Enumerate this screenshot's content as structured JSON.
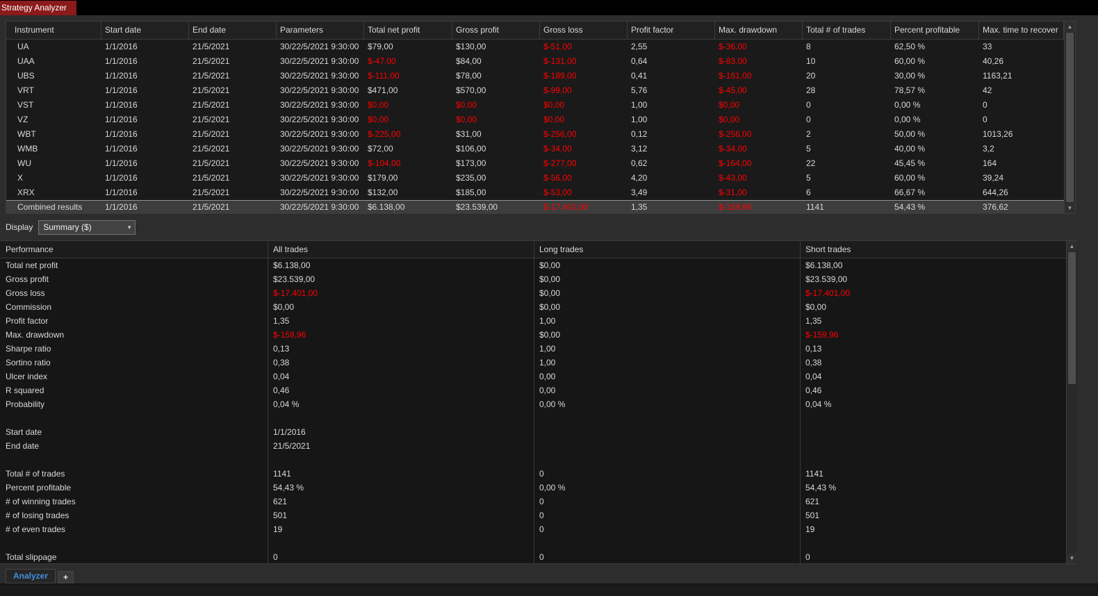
{
  "title_tab": {
    "label": "Strategy Analyzer"
  },
  "results_table": {
    "columns": [
      "Instrument",
      "Start date",
      "End date",
      "Parameters",
      "Total net profit",
      "Gross profit",
      "Gross loss",
      "Profit factor",
      "Max. drawdown",
      "Total # of trades",
      "Percent profitable",
      "Max. time to recover"
    ],
    "rows": [
      {
        "cells": [
          "UA",
          "1/1/2016",
          "21/5/2021",
          "30/22/5/2021 9:30:00",
          "$79,00",
          "$130,00",
          "$-51,00",
          "2,55",
          "$-36,00",
          "8",
          "62,50 %",
          "33"
        ],
        "red": [
          6,
          8
        ]
      },
      {
        "cells": [
          "UAA",
          "1/1/2016",
          "21/5/2021",
          "30/22/5/2021 9:30:00",
          "$-47,00",
          "$84,00",
          "$-131,00",
          "0,64",
          "$-83,00",
          "10",
          "60,00 %",
          "40,26"
        ],
        "red": [
          4,
          6,
          8
        ]
      },
      {
        "cells": [
          "UBS",
          "1/1/2016",
          "21/5/2021",
          "30/22/5/2021 9:30:00",
          "$-111,00",
          "$78,00",
          "$-189,00",
          "0,41",
          "$-161,00",
          "20",
          "30,00 %",
          "1163,21"
        ],
        "red": [
          4,
          6,
          8
        ]
      },
      {
        "cells": [
          "VRT",
          "1/1/2016",
          "21/5/2021",
          "30/22/5/2021 9:30:00",
          "$471,00",
          "$570,00",
          "$-99,00",
          "5,76",
          "$-45,00",
          "28",
          "78,57 %",
          "42"
        ],
        "red": [
          6,
          8
        ]
      },
      {
        "cells": [
          "VST",
          "1/1/2016",
          "21/5/2021",
          "30/22/5/2021 9:30:00",
          "$0,00",
          "$0,00",
          "$0,00",
          "1,00",
          "$0,00",
          "0",
          "0,00 %",
          "0"
        ],
        "red": [
          4,
          5,
          6,
          8
        ]
      },
      {
        "cells": [
          "VZ",
          "1/1/2016",
          "21/5/2021",
          "30/22/5/2021 9:30:00",
          "$0,00",
          "$0,00",
          "$0,00",
          "1,00",
          "$0,00",
          "0",
          "0,00 %",
          "0"
        ],
        "red": [
          4,
          5,
          6,
          8
        ]
      },
      {
        "cells": [
          "WBT",
          "1/1/2016",
          "21/5/2021",
          "30/22/5/2021 9:30:00",
          "$-225,00",
          "$31,00",
          "$-256,00",
          "0,12",
          "$-256,00",
          "2",
          "50,00 %",
          "1013,26"
        ],
        "red": [
          4,
          6,
          8
        ]
      },
      {
        "cells": [
          "WMB",
          "1/1/2016",
          "21/5/2021",
          "30/22/5/2021 9:30:00",
          "$72,00",
          "$106,00",
          "$-34,00",
          "3,12",
          "$-34,00",
          "5",
          "40,00 %",
          "3,2"
        ],
        "red": [
          6,
          8
        ]
      },
      {
        "cells": [
          "WU",
          "1/1/2016",
          "21/5/2021",
          "30/22/5/2021 9:30:00",
          "$-104,00",
          "$173,00",
          "$-277,00",
          "0,62",
          "$-164,00",
          "22",
          "45,45 %",
          "164"
        ],
        "red": [
          4,
          6,
          8
        ]
      },
      {
        "cells": [
          "X",
          "1/1/2016",
          "21/5/2021",
          "30/22/5/2021 9:30:00",
          "$179,00",
          "$235,00",
          "$-56,00",
          "4,20",
          "$-43,00",
          "5",
          "60,00 %",
          "39,24"
        ],
        "red": [
          6,
          8
        ]
      },
      {
        "cells": [
          "XRX",
          "1/1/2016",
          "21/5/2021",
          "30/22/5/2021 9:30:00",
          "$132,00",
          "$185,00",
          "$-53,00",
          "3,49",
          "$-31,00",
          "6",
          "66,67 %",
          "644,26"
        ],
        "red": [
          6,
          8
        ]
      },
      {
        "cells": [
          "Combined results",
          "1/1/2016",
          "21/5/2021",
          "30/22/5/2021 9:30:00",
          "$6.138,00",
          "$23.539,00",
          "$-17.401,00",
          "1,35",
          "$-159,96",
          "1141",
          "54,43 %",
          "376,62"
        ],
        "red": [
          6,
          8
        ],
        "highlight": true
      }
    ]
  },
  "display": {
    "label": "Display",
    "selected": "Summary ($)"
  },
  "performance_table": {
    "columns": [
      "Performance",
      "All trades",
      "Long trades",
      "Short trades"
    ],
    "rows": [
      {
        "label": "Total net profit",
        "values": [
          "$6.138,00",
          "$0,00",
          "$6.138,00"
        ],
        "red": []
      },
      {
        "label": "Gross profit",
        "values": [
          "$23.539,00",
          "$0,00",
          "$23.539,00"
        ],
        "red": []
      },
      {
        "label": "Gross loss",
        "values": [
          "$-17.401,00",
          "$0,00",
          "$-17.401,00"
        ],
        "red": [
          0,
          2
        ]
      },
      {
        "label": "Commission",
        "values": [
          "$0,00",
          "$0,00",
          "$0,00"
        ],
        "red": []
      },
      {
        "label": "Profit factor",
        "values": [
          "1,35",
          "1,00",
          "1,35"
        ],
        "red": []
      },
      {
        "label": "Max. drawdown",
        "values": [
          "$-159,96",
          "$0,00",
          "$-159,96"
        ],
        "red": [
          0,
          2
        ]
      },
      {
        "label": "Sharpe ratio",
        "values": [
          "0,13",
          "1,00",
          "0,13"
        ],
        "red": []
      },
      {
        "label": "Sortino ratio",
        "values": [
          "0,38",
          "1,00",
          "0,38"
        ],
        "red": []
      },
      {
        "label": "Ulcer index",
        "values": [
          "0,04",
          "0,00",
          "0,04"
        ],
        "red": []
      },
      {
        "label": "R squared",
        "values": [
          "0,46",
          "0,00",
          "0,46"
        ],
        "red": []
      },
      {
        "label": "Probability",
        "values": [
          "0,04 %",
          "0,00 %",
          "0,04 %"
        ],
        "red": []
      },
      {
        "label": "",
        "values": [
          "",
          "",
          ""
        ],
        "red": []
      },
      {
        "label": "Start date",
        "values": [
          "1/1/2016",
          "",
          ""
        ],
        "red": []
      },
      {
        "label": "End date",
        "values": [
          "21/5/2021",
          "",
          ""
        ],
        "red": []
      },
      {
        "label": "",
        "values": [
          "",
          "",
          ""
        ],
        "red": []
      },
      {
        "label": "Total # of trades",
        "values": [
          "1141",
          "0",
          "1141"
        ],
        "red": []
      },
      {
        "label": "Percent profitable",
        "values": [
          "54,43 %",
          "0,00 %",
          "54,43 %"
        ],
        "red": []
      },
      {
        "label": "# of winning trades",
        "values": [
          "621",
          "0",
          "621"
        ],
        "red": []
      },
      {
        "label": "# of losing trades",
        "values": [
          "501",
          "0",
          "501"
        ],
        "red": []
      },
      {
        "label": "# of even trades",
        "values": [
          "19",
          "0",
          "19"
        ],
        "red": []
      },
      {
        "label": "",
        "values": [
          "",
          "",
          ""
        ],
        "red": []
      },
      {
        "label": "Total slippage",
        "values": [
          "0",
          "0",
          "0"
        ],
        "red": []
      }
    ]
  },
  "bottom_tabs": {
    "analyzer_label": "Analyzer",
    "add_tab_label": "+"
  },
  "scrollbar": {
    "up_icon": "▲",
    "down_icon": "▼"
  },
  "dropdown_icon": "▾",
  "colors": {
    "negative": "#ff0000",
    "title_tab_bg": "#8b1a1a",
    "active_tab_text": "#4090dd"
  }
}
